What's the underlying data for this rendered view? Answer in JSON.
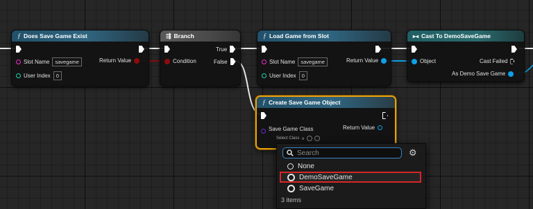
{
  "nodes": {
    "does_save_game_exist": {
      "title": "Does Save Game Exist",
      "slot_name_label": "Slot Name",
      "slot_name_value": "savegame",
      "user_index_label": "User Index",
      "user_index_value": "0",
      "return_label": "Return Value"
    },
    "branch": {
      "title": "Branch",
      "true_label": "True",
      "false_label": "False",
      "condition_label": "Condition"
    },
    "load_game_from_slot": {
      "title": "Load Game from Slot",
      "slot_name_label": "Slot Name",
      "slot_name_value": "savegame",
      "user_index_label": "User Index",
      "user_index_value": "0",
      "return_label": "Return Value"
    },
    "cast_to_demo_save_game": {
      "title": "Cast To DemoSaveGame",
      "object_label": "Object",
      "cast_failed_label": "Cast Failed",
      "as_label": "As Demo Save Game"
    },
    "create_save_game_object": {
      "title": "Create Save Game Object",
      "class_label": "Save Game Class",
      "return_label": "Return Value",
      "select_class": "Select Class"
    }
  },
  "picker": {
    "search_placeholder": "Search",
    "items": [
      {
        "label": "None",
        "icon": "none-circle-icon"
      },
      {
        "label": "DemoSaveGame",
        "icon": "class-icon",
        "highlighted": true
      },
      {
        "label": "SaveGame",
        "icon": "class-icon"
      }
    ],
    "count_text": "3 items"
  },
  "colors": {
    "exec": "#ffffff",
    "string_pin": "#f02fd0",
    "int_pin": "#1ed4a8",
    "bool_pin": "#8f0b0b",
    "object_pin": "#0fa0e8",
    "class_pin": "#6a2ec8",
    "selection": "#e8a00e",
    "highlight": "#d7262a"
  }
}
